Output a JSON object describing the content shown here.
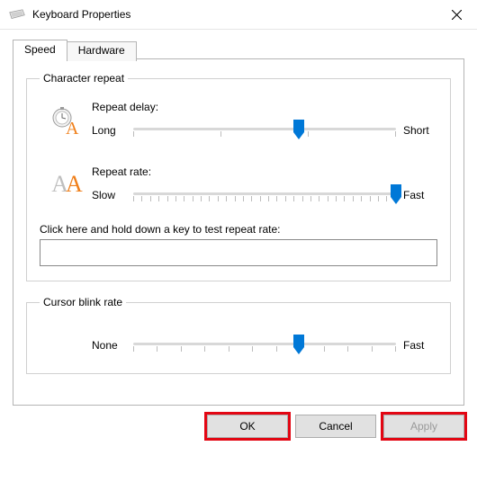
{
  "window": {
    "title": "Keyboard Properties"
  },
  "tabs": {
    "speed": "Speed",
    "hardware": "Hardware"
  },
  "character_repeat": {
    "legend": "Character repeat",
    "delay": {
      "label": "Repeat delay:",
      "min": "Long",
      "max": "Short",
      "ticks": 4,
      "value_pct": 63
    },
    "rate": {
      "label": "Repeat rate:",
      "min": "Slow",
      "max": "Fast",
      "ticks": 32,
      "value_pct": 100
    },
    "test_label": "Click here and hold down a key to test repeat rate:",
    "test_value": ""
  },
  "cursor_blink": {
    "legend": "Cursor blink rate",
    "min": "None",
    "max": "Fast",
    "ticks": 12,
    "value_pct": 63
  },
  "buttons": {
    "ok": "OK",
    "cancel": "Cancel",
    "apply": "Apply"
  },
  "colors": {
    "accent": "#0078d7",
    "highlight": "#e30613"
  }
}
